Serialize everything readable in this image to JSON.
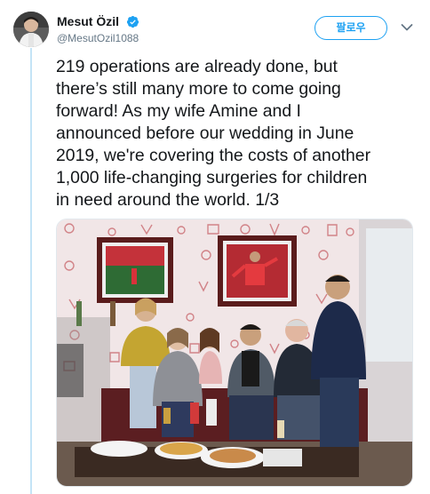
{
  "tweet": {
    "author": {
      "display_name": "Mesut Özil",
      "handle": "@MesutOzil1088",
      "verified": true,
      "avatar_icon": "profile-avatar"
    },
    "follow_label": "팔로우",
    "menu_icon": "chevron-down-icon",
    "text": "219 operations are already done, but\nthere’s still many more to come going\nforward! As my wife Amine and I\nannounced before our wedding in June\n2019, we're covering the costs of another\n1,000 life-changing surgeries for children\nin need around the world. 1/3",
    "media": {
      "kind": "photo",
      "alt": ""
    }
  },
  "colors": {
    "accent": "#1da1f2",
    "thread_line": "#c4e4f6",
    "text_primary": "#14171a",
    "text_secondary": "#657786",
    "wall": "#f3e9ea",
    "wall_pattern": "#b5262f"
  }
}
